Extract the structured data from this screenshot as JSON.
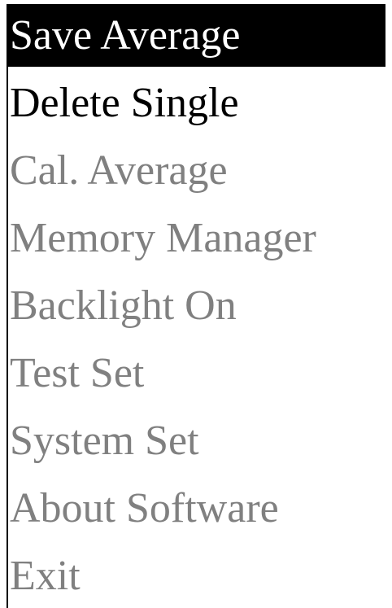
{
  "menu": {
    "items": [
      {
        "label": "Save Average",
        "state": "selected"
      },
      {
        "label": "Delete Single",
        "state": "enabled"
      },
      {
        "label": "Cal. Average",
        "state": "disabled"
      },
      {
        "label": "Memory Manager",
        "state": "disabled"
      },
      {
        "label": "Backlight On",
        "state": "disabled"
      },
      {
        "label": "Test Set",
        "state": "disabled"
      },
      {
        "label": "System Set",
        "state": "disabled"
      },
      {
        "label": "About Software",
        "state": "disabled"
      },
      {
        "label": "Exit",
        "state": "disabled"
      }
    ]
  },
  "colors": {
    "selected_background": "#000000",
    "selected_text": "#ffffff",
    "enabled_text": "#000000",
    "disabled_text": "#808080"
  }
}
